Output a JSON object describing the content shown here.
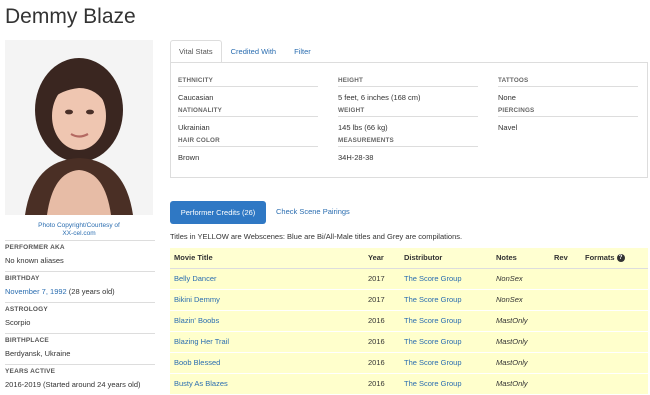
{
  "performer": {
    "name": "Demmy Blaze"
  },
  "photo": {
    "caption_line1": "Photo Copyright/Courtesy of",
    "caption_line2": "XX-cel.com"
  },
  "sidebar": {
    "aka_label": "Performer AKA",
    "aka_value": "No known aliases",
    "birthday_label": "Birthday",
    "birthday_date": "November 7, 1992",
    "birthday_age": "(28 years old)",
    "astrology_label": "Astrology",
    "astrology_value": "Scorpio",
    "birthplace_label": "Birthplace",
    "birthplace_value": "Berdyansk, Ukraine",
    "years_label": "Years Active",
    "years_value": "2016-2019 (Started around 24 years old)"
  },
  "tabs": [
    "Vital Stats",
    "Credited With",
    "Filter"
  ],
  "vitals": {
    "ethnicity_label": "Ethnicity",
    "ethnicity": "Caucasian",
    "nationality_label": "Nationality",
    "nationality": "Ukrainian",
    "hair_label": "Hair Color",
    "hair": "Brown",
    "height_label": "Height",
    "height": "5 feet, 6 inches (168 cm)",
    "weight_label": "Weight",
    "weight": "145 lbs (66 kg)",
    "measurements_label": "Measurements",
    "measurements": "34H-28-38",
    "tattoos_label": "Tattoos",
    "tattoos": "None",
    "piercings_label": "Piercings",
    "piercings": "Navel"
  },
  "credits": {
    "button_label": "Performer Credits (26)",
    "pairings_label": "Check Scene Pairings",
    "legend": "Titles in YELLOW are Webscenes: Blue are Bi/All-Male titles and Grey are compilations.",
    "columns": [
      "Movie Title",
      "Year",
      "Distributor",
      "Notes",
      "Rev",
      "Formats"
    ],
    "rows": [
      {
        "title": "Belly Dancer",
        "year": "2017",
        "distributor": "The Score Group",
        "notes": "NonSex"
      },
      {
        "title": "Bikini Demmy",
        "year": "2017",
        "distributor": "The Score Group",
        "notes": "NonSex"
      },
      {
        "title": "Blazin' Boobs",
        "year": "2016",
        "distributor": "The Score Group",
        "notes": "MastOnly"
      },
      {
        "title": "Blazing Her Trail",
        "year": "2016",
        "distributor": "The Score Group",
        "notes": "MastOnly"
      },
      {
        "title": "Boob Blessed",
        "year": "2016",
        "distributor": "The Score Group",
        "notes": "MastOnly"
      },
      {
        "title": "Busty As Blazes",
        "year": "2016",
        "distributor": "The Score Group",
        "notes": "MastOnly"
      }
    ]
  },
  "colors": {
    "accent": "#2f78c4",
    "link": "#2a6db0",
    "webscene_row": "#ffffcc"
  }
}
